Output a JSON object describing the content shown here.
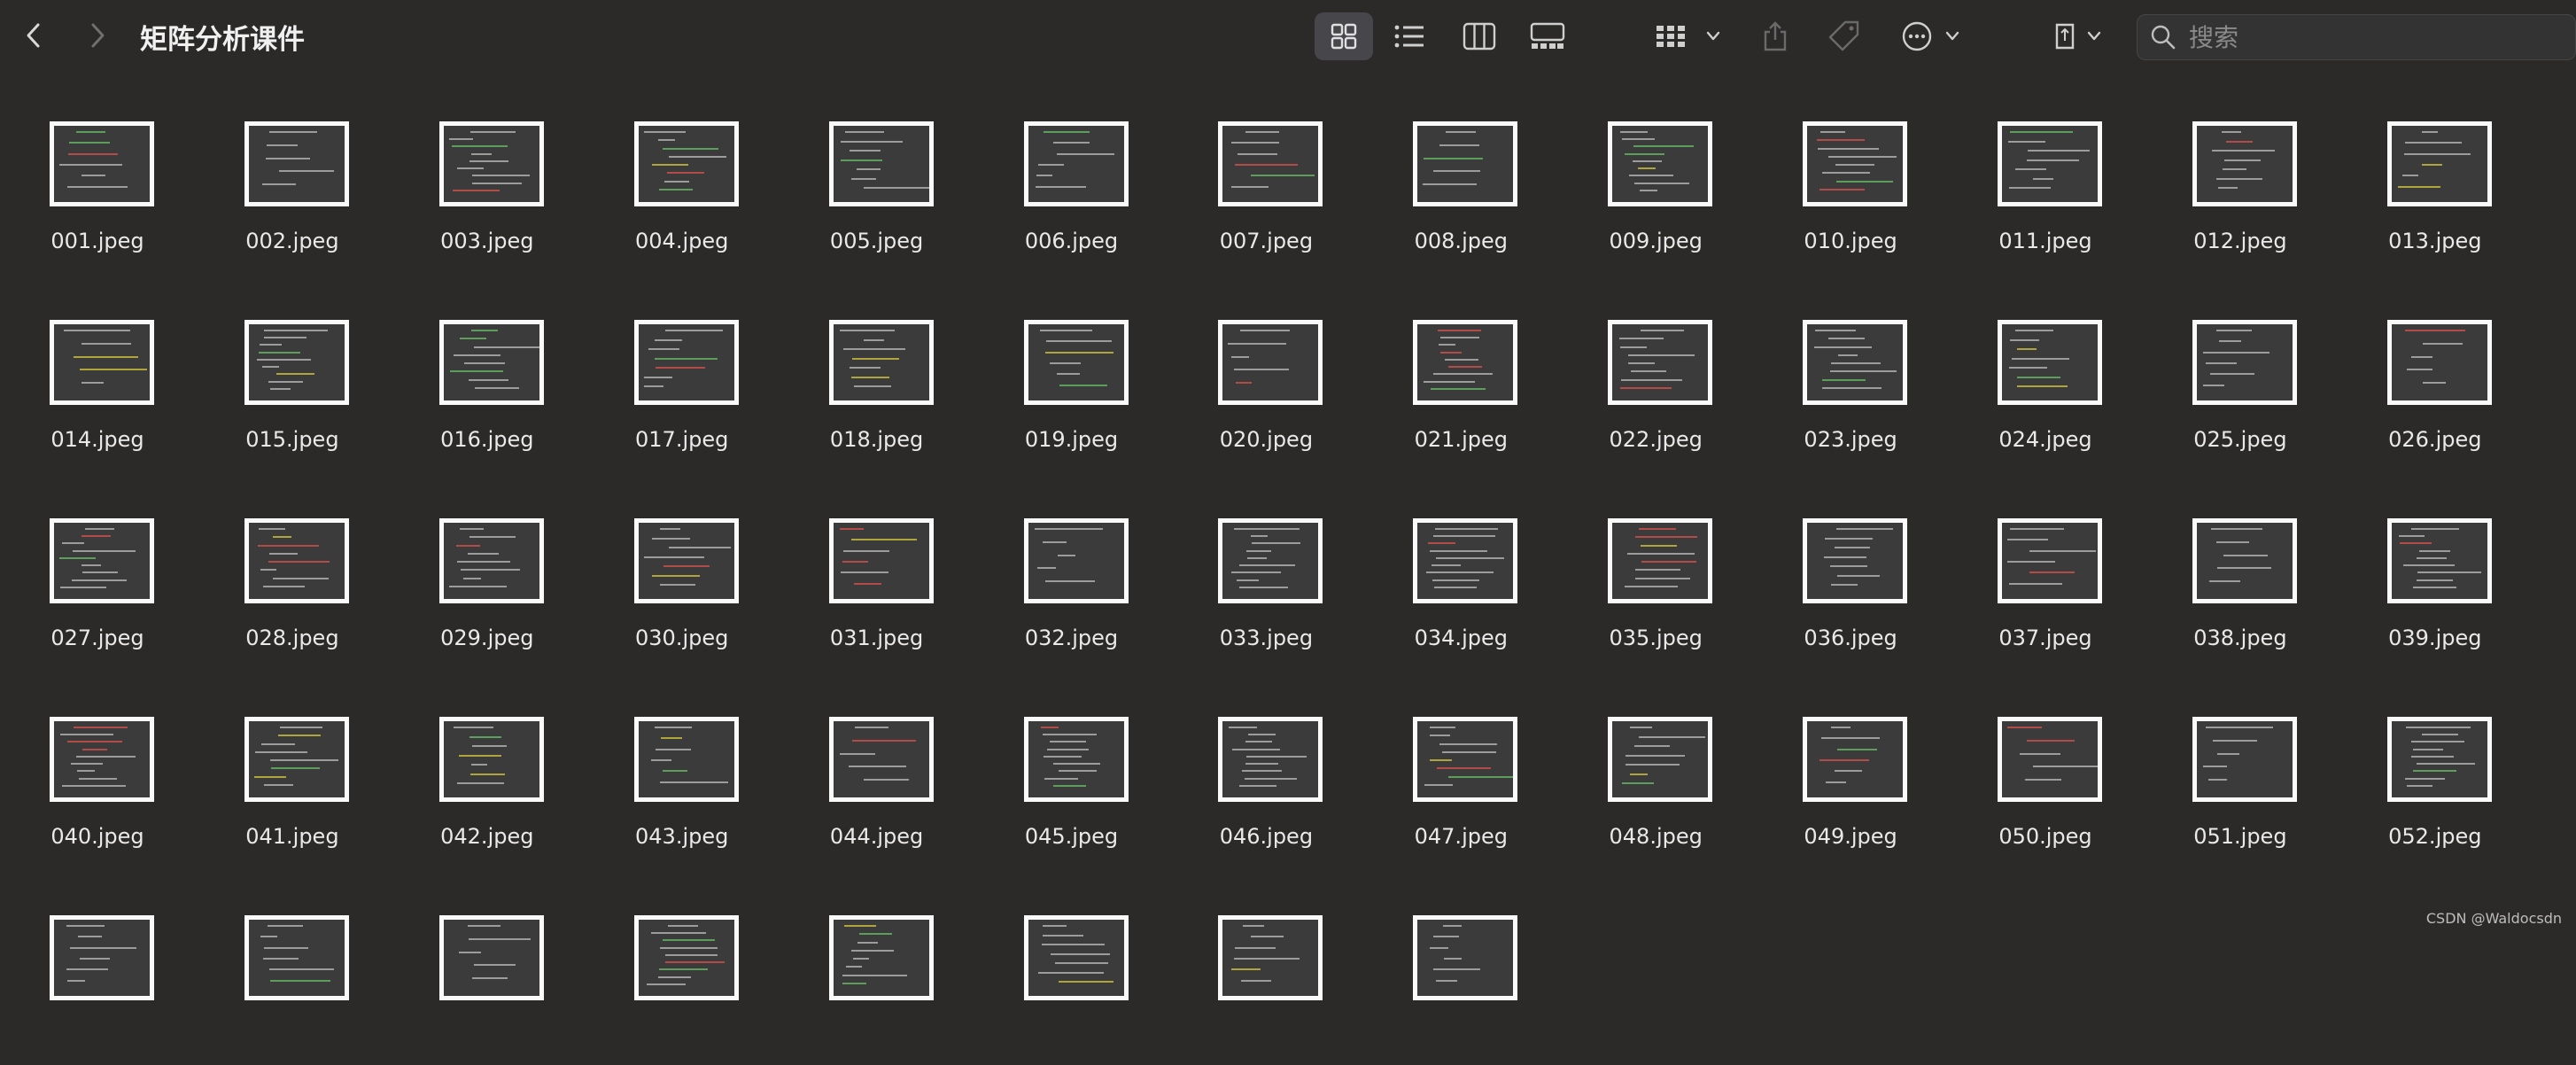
{
  "toolbar": {
    "back_icon": "chevron-left-icon",
    "forward_icon": "chevron-right-icon",
    "title": "矩阵分析课件",
    "view_icons": [
      "grid-view-icon",
      "list-view-icon",
      "column-view-icon",
      "gallery-view-icon"
    ],
    "group_icon": "group-by-icon",
    "share_icon": "share-icon",
    "tag_icon": "tag-icon",
    "more_icon": "ellipsis-circle-icon",
    "eject_icon": "sd-card-icon"
  },
  "search": {
    "placeholder": "搜索",
    "icon": "search-icon"
  },
  "files": [
    "001.jpeg",
    "002.jpeg",
    "003.jpeg",
    "004.jpeg",
    "005.jpeg",
    "006.jpeg",
    "007.jpeg",
    "008.jpeg",
    "009.jpeg",
    "010.jpeg",
    "011.jpeg",
    "012.jpeg",
    "013.jpeg",
    "014.jpeg",
    "015.jpeg",
    "016.jpeg",
    "017.jpeg",
    "018.jpeg",
    "019.jpeg",
    "020.jpeg",
    "021.jpeg",
    "022.jpeg",
    "023.jpeg",
    "024.jpeg",
    "025.jpeg",
    "026.jpeg",
    "027.jpeg",
    "028.jpeg",
    "029.jpeg",
    "030.jpeg",
    "031.jpeg",
    "032.jpeg",
    "033.jpeg",
    "034.jpeg",
    "035.jpeg",
    "036.jpeg",
    "037.jpeg",
    "038.jpeg",
    "039.jpeg",
    "040.jpeg",
    "041.jpeg",
    "042.jpeg",
    "043.jpeg",
    "044.jpeg",
    "045.jpeg",
    "046.jpeg",
    "047.jpeg",
    "048.jpeg",
    "049.jpeg",
    "050.jpeg",
    "051.jpeg",
    "052.jpeg"
  ],
  "partial_row_count": 8,
  "watermark": "CSDN @Waldocsdn",
  "colors": {
    "background": "#2b2a29",
    "thumbnail_border": "#fafafa",
    "slide_bg": "#3b3b3b"
  }
}
